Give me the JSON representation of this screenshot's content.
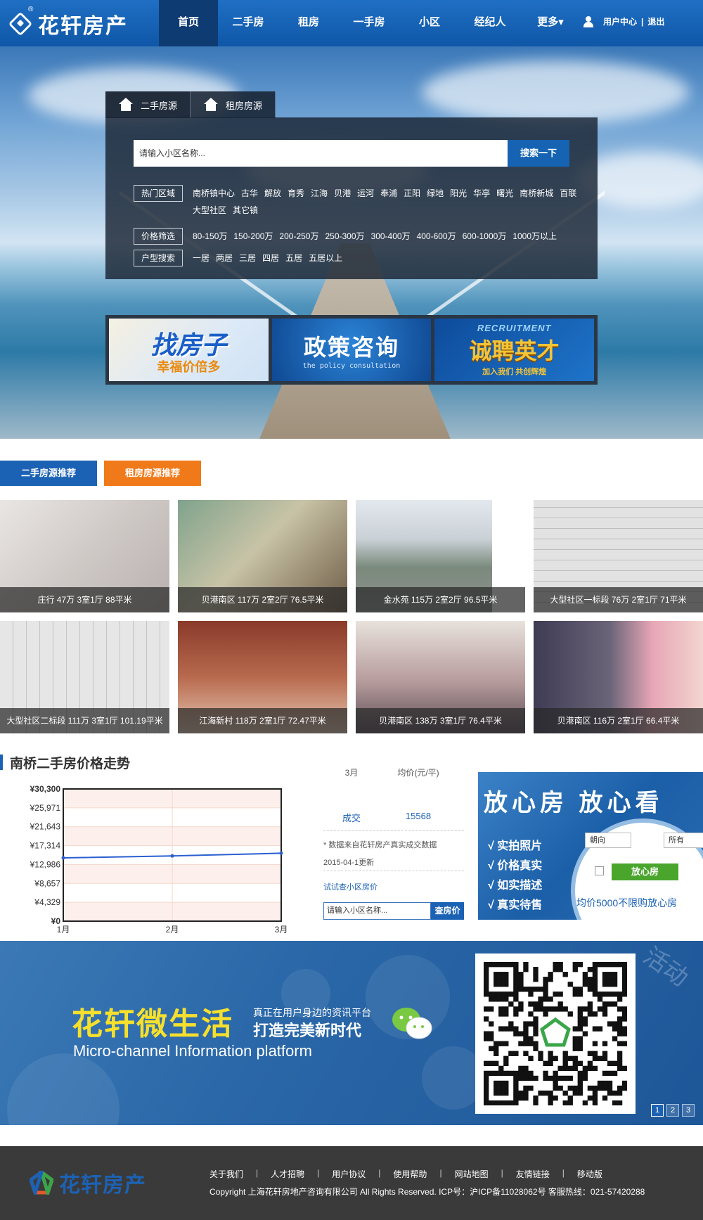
{
  "header": {
    "logo_text": "花轩房产",
    "nav": [
      {
        "label": "首页",
        "active": true
      },
      {
        "label": "二手房",
        "active": false
      },
      {
        "label": "租房",
        "active": false
      },
      {
        "label": "一手房",
        "active": false
      },
      {
        "label": "小区",
        "active": false
      },
      {
        "label": "经纪人",
        "active": false
      },
      {
        "label": "更多▾",
        "active": false
      }
    ],
    "user_center": "用户中心",
    "divider": "|",
    "logout": "退出"
  },
  "search": {
    "tabs": [
      "二手房源",
      "租房房源"
    ],
    "placeholder": "请输入小区名称...",
    "button": "搜索一下",
    "filters": [
      {
        "label": "热门区域",
        "options": [
          "南桥镇中心",
          "古华",
          "解放",
          "育秀",
          "江海",
          "贝港",
          "运河",
          "奉浦",
          "正阳",
          "绿地",
          "阳光",
          "华亭",
          "曙光",
          "南桥新城",
          "百联",
          "大型社区",
          "其它镇"
        ]
      },
      {
        "label": "价格筛选",
        "options": [
          "80-150万",
          "150-200万",
          "200-250万",
          "250-300万",
          "300-400万",
          "400-600万",
          "600-1000万",
          "1000万以上"
        ]
      },
      {
        "label": "户型搜索",
        "options": [
          "一居",
          "两居",
          "三居",
          "四居",
          "五居",
          "五居以上"
        ]
      }
    ]
  },
  "banners": [
    {
      "title": "找房子",
      "sub": "幸福价倍多"
    },
    {
      "title": "政策咨询",
      "sub": "the policy consultation"
    },
    {
      "title": "诚聘英才",
      "top": "RECRUITMENT",
      "sub": "加入我们 共创辉煌"
    }
  ],
  "recommend_tabs": [
    "二手房源推荐",
    "租房房源推荐"
  ],
  "listings": [
    "庄行 47万 3室1厅 88平米",
    "贝港南区 117万 2室2厅 76.5平米",
    "金水苑 115万 2室2厅 96.5平米",
    "大型社区一标段 76万 2室1厅 71平米",
    "大型社区二标段 111万 3室1厅 101.19平米",
    "江海新村 118万 2室1厅 72.47平米",
    "贝港南区 138万 3室1厅 76.4平米",
    "贝港南区 116万 2室1厅 66.4平米"
  ],
  "trend": {
    "title": "南桥二手房价格走势",
    "col_month": "3月",
    "col_avg": "均价(元/平)",
    "row_label": "成交",
    "row_value": "15568",
    "source_note": "* 数据来自花轩房产真实成交数据",
    "update_note": "2015-04-1更新",
    "try_link": "试试查小区房价",
    "input_placeholder": "请输入小区名称...",
    "button": "查房价"
  },
  "chart_data": {
    "type": "line",
    "categories": [
      "1月",
      "2月",
      "3月"
    ],
    "series": [
      {
        "values": [
          14500,
          14950,
          15568
        ]
      }
    ],
    "yticks": [
      "¥0",
      "¥4,329",
      "¥8,657",
      "¥12,986",
      "¥17,314",
      "¥21,643",
      "¥25,971",
      "¥30,300"
    ],
    "ylim": [
      0,
      30300
    ],
    "grid": true,
    "line_color": "#2a5fd0"
  },
  "promo": {
    "headline": "放心房 放心看",
    "items": [
      "√  实拍照片",
      "√  价格真实",
      "√  如实描述",
      "√  真实待售"
    ],
    "select1": "朝向",
    "select2": "所有",
    "badge": "放心房",
    "price_note": "均价5000不限购放心房"
  },
  "wechat": {
    "title": "花轩微生活",
    "line1": "真正在用户身边的资讯平台",
    "line2": "打造完美新时代",
    "english": "Micro-channel Information platform",
    "corner": "活动",
    "pages": [
      "1",
      "2",
      "3"
    ]
  },
  "footer": {
    "logo_text": "花轩房产",
    "links": [
      "关于我们",
      "人才招聘",
      "用户协议",
      "使用帮助",
      "网站地图",
      "友情链接",
      "移动版"
    ],
    "separator": "|",
    "copyright": "Copyright 上海花轩房地产咨询有限公司 All Rights Reserved. ICP号：沪ICP备11028062号 客服热线：021-57420288"
  },
  "colors": {
    "brand_blue": "#1c62b4",
    "nav_active": "#0d3b72",
    "rent_orange": "#f07a1a",
    "promo_green": "#49a52c"
  }
}
